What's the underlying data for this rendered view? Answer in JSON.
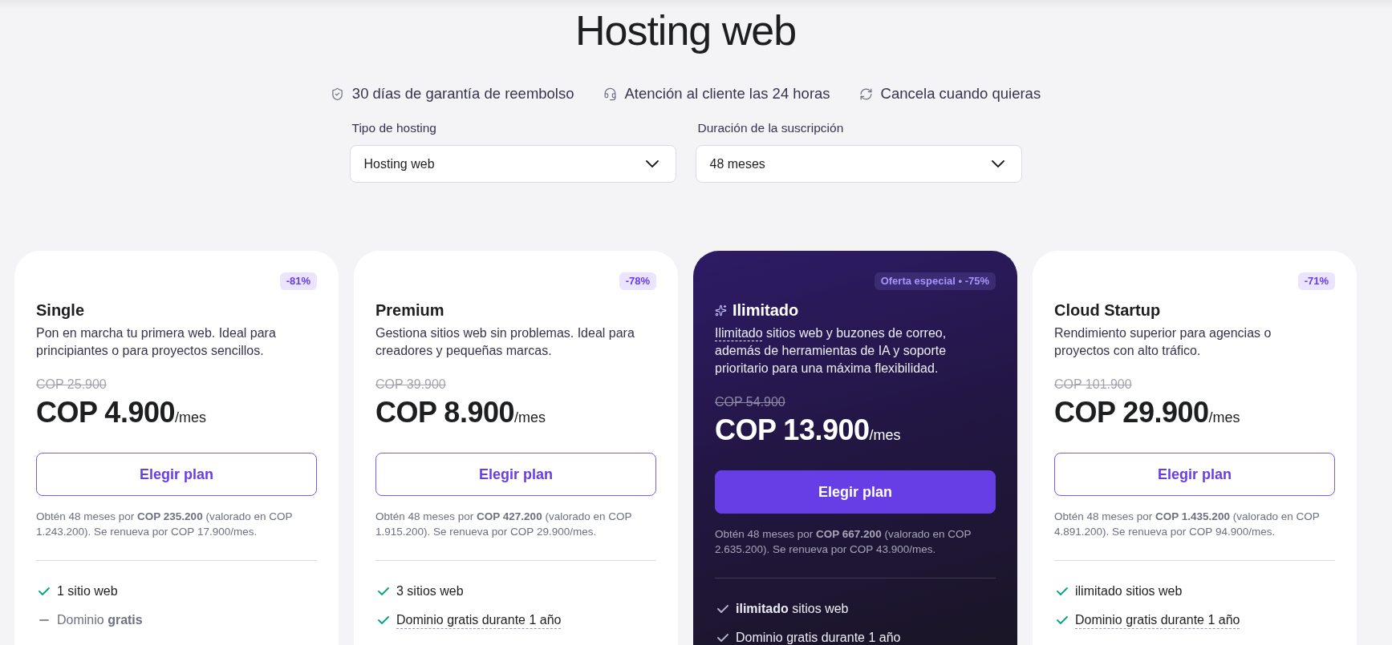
{
  "page_title": "Hosting web",
  "guarantees": [
    {
      "text": "30 días de garantía de reembolso"
    },
    {
      "text": "Atención al cliente las 24 horas"
    },
    {
      "text": "Cancela cuando quieras"
    }
  ],
  "filters": [
    {
      "label": "Tipo de hosting",
      "value": "Hosting web"
    },
    {
      "label": "Duración de la suscripción",
      "value": "48 meses"
    }
  ],
  "plans": [
    {
      "name": "Single",
      "featured": false,
      "badge": "-81%",
      "description": "Pon en marcha tu primera web. Ideal para principiantes o para proyectos sencillos.",
      "old_price": "COP 25.900",
      "price": "COP 4.900",
      "period": "/mes",
      "button": "Elegir plan",
      "note": "Obtén 48 meses por **COP 235.200** (valorado en COP 1.243.200). Se renueva por COP 17.900/mes.",
      "features": [
        {
          "text": "1 sitio web",
          "included": true,
          "underlined": false
        },
        {
          "text": "Dominio **gratis**",
          "included": false,
          "underlined": false
        }
      ]
    },
    {
      "name": "Premium",
      "featured": false,
      "badge": "-78%",
      "description": "Gestiona sitios web sin problemas. Ideal para creadores y pequeñas marcas.",
      "old_price": "COP 39.900",
      "price": "COP 8.900",
      "period": "/mes",
      "button": "Elegir plan",
      "note": "Obtén 48 meses por **COP 427.200** (valorado en COP 1.915.200). Se renueva por COP 29.900/mes.",
      "features": [
        {
          "text": "3 sitios web",
          "included": true,
          "underlined": false
        },
        {
          "text": "Dominio gratis durante 1 año",
          "included": true,
          "underlined": true
        }
      ]
    },
    {
      "name": "Ilimitado",
      "featured": true,
      "badge": "Oferta especial • -75%",
      "description_term": "Ilimitado",
      "description": "sitios web y buzones de correo, además de herramientas de IA y soporte prioritario para una máxima flexibilidad.",
      "old_price": "COP 54.900",
      "price": "COP 13.900",
      "period": "/mes",
      "button": "Elegir plan",
      "note": "Obtén 48 meses por **COP 667.200** (valorado en COP 2.635.200). Se renueva por COP 43.900/mes.",
      "features": [
        {
          "text": "**ilimitado** sitios web",
          "included": true
        },
        {
          "text": "Dominio gratis durante 1 año",
          "included": true
        }
      ]
    },
    {
      "name": "Cloud Startup",
      "featured": false,
      "badge": "-71%",
      "description": "Rendimiento superior para agencias o proyectos con alto tráfico.",
      "old_price": "COP 101.900",
      "price": "COP 29.900",
      "period": "/mes",
      "button": "Elegir plan",
      "note": "Obtén 48 meses por **COP 1.435.200** (valorado en COP 4.891.200). Se renueva por COP 94.900/mes.",
      "features": [
        {
          "text": "ilimitado sitios web",
          "included": true,
          "underlined": false
        },
        {
          "text": "Dominio gratis durante 1 año",
          "included": true,
          "underlined": true
        }
      ]
    }
  ]
}
